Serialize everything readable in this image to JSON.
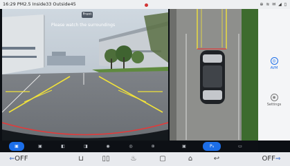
{
  "status": {
    "left_text": "16:29 PM2.5 Inside33 Outside45",
    "right_text": "⊕ ≋ ✉ ◢ ▯"
  },
  "camera": {
    "tag": "Front",
    "message": "Please watch the surroundings"
  },
  "right_panel": {
    "items": [
      {
        "label": "AVM",
        "icon": "avm-icon",
        "active": true
      },
      {
        "label": "Settings",
        "icon": "settings-icon",
        "active": false
      }
    ]
  },
  "camera_buttons": [
    {
      "icon": "front-camera-icon",
      "glyph": "▣",
      "active": true
    },
    {
      "icon": "rear-camera-icon",
      "glyph": "▣",
      "active": false
    },
    {
      "icon": "left-camera-icon",
      "glyph": "◧",
      "active": false
    },
    {
      "icon": "right-camera-icon",
      "glyph": "◨",
      "active": false
    },
    {
      "icon": "front-wide-icon",
      "glyph": "◉",
      "active": false
    },
    {
      "icon": "rear-wide-icon",
      "glyph": "◎",
      "active": false
    },
    {
      "icon": "3d-view-icon",
      "glyph": "⊛",
      "active": false
    }
  ],
  "view_buttons": [
    {
      "icon": "car-view-icon",
      "glyph": "▣",
      "active": false
    },
    {
      "icon": "parking-assist-icon",
      "glyph": "P₄",
      "active": true
    },
    {
      "icon": "record-icon",
      "glyph": "▭",
      "active": false
    }
  ],
  "bottom_bar": {
    "left_off": "OFF",
    "right_off": "OFF",
    "nav": [
      {
        "icon": "seat-icon",
        "glyph": "⊔"
      },
      {
        "icon": "split-screen-icon",
        "glyph": "▯▯"
      },
      {
        "icon": "fan-icon",
        "glyph": "♨"
      },
      {
        "icon": "overview-icon",
        "glyph": "▢"
      },
      {
        "icon": "home-icon",
        "glyph": "⌂"
      },
      {
        "icon": "back-icon",
        "glyph": "↩"
      }
    ]
  },
  "colors": {
    "accent": "#1c6ee8",
    "status_bar": "#eef0f2",
    "camera_bar": "#0d1015",
    "bottom_bar": "#e8eaee"
  }
}
